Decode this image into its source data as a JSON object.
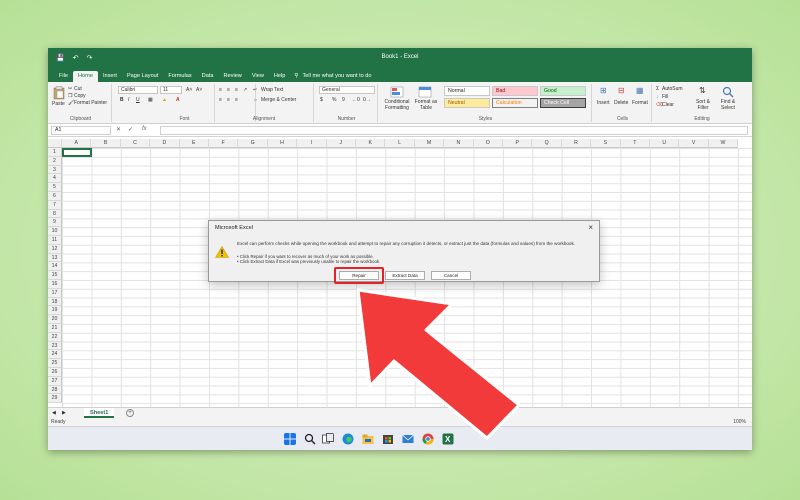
{
  "window": {
    "title": "Book1 - Excel"
  },
  "tabs": [
    "File",
    "Home",
    "Insert",
    "Page Layout",
    "Formulas",
    "Data",
    "Review",
    "View",
    "Help"
  ],
  "active_tab": "Home",
  "tell_me": "Tell me what you want to do",
  "ribbon": {
    "clipboard": {
      "label": "Clipboard",
      "paste": "Paste",
      "cut": "Cut",
      "copy": "Copy",
      "format_painter": "Format Painter"
    },
    "font": {
      "label": "Font",
      "font_name": "Calibri",
      "font_size": "11",
      "bold": "B",
      "italic": "I",
      "underline": "U"
    },
    "alignment": {
      "label": "Alignment",
      "wrap_text": "Wrap Text",
      "merge_center": "Merge & Center"
    },
    "number": {
      "label": "Number",
      "format": "General",
      "currency": "$",
      "percent": "%",
      "comma": "9"
    },
    "styles": {
      "label": "Styles",
      "conditional_formatting": "Conditional Formatting",
      "format_as_table": "Format as Table",
      "normal": "Normal",
      "bad": "Bad",
      "good": "Good",
      "neutral": "Neutral",
      "calculation": "Calculation",
      "check_cell": "Check Cell"
    },
    "cells": {
      "label": "Cells",
      "insert": "Insert",
      "delete": "Delete",
      "format": "Format"
    },
    "editing": {
      "label": "Editing",
      "autosum": "AutoSum",
      "fill": "Fill",
      "clear": "Clear",
      "sort_filter": "Sort & Filter",
      "find_select": "Find & Select"
    }
  },
  "formula_bar": {
    "name_box": "A1",
    "fx": "fx"
  },
  "columns": [
    "A",
    "B",
    "C",
    "D",
    "E",
    "F",
    "G",
    "H",
    "I",
    "J",
    "K",
    "L",
    "M",
    "N",
    "O",
    "P",
    "Q",
    "R",
    "S",
    "T",
    "U",
    "V",
    "W"
  ],
  "rows": [
    "1",
    "2",
    "3",
    "4",
    "5",
    "6",
    "7",
    "8",
    "9",
    "10",
    "11",
    "12",
    "13",
    "14",
    "15",
    "16",
    "17",
    "18",
    "19",
    "20",
    "21",
    "22",
    "23",
    "24",
    "25",
    "26",
    "27",
    "28",
    "29"
  ],
  "sheet_tab": "Sheet1",
  "status": {
    "ready": "Ready",
    "zoom": "100%"
  },
  "dialog": {
    "title": "Microsoft Excel",
    "message": "Excel can perform checks while opening the workbook and attempt to repair any corruption it detects, or extract just the data (formulas and values) from the workbook.",
    "bullet1": "• Click Repair if you want to recover as much of your work as possible.",
    "bullet2": "• Click Extract Data if Excel was previously unable to repair the workbook.",
    "buttons": {
      "repair": "Repair",
      "extract": "Extract Data",
      "cancel": "Cancel"
    }
  },
  "colors": {
    "excel_green": "#217346",
    "highlight_red": "#e4222a",
    "arrow_red": "#f23a3a"
  }
}
